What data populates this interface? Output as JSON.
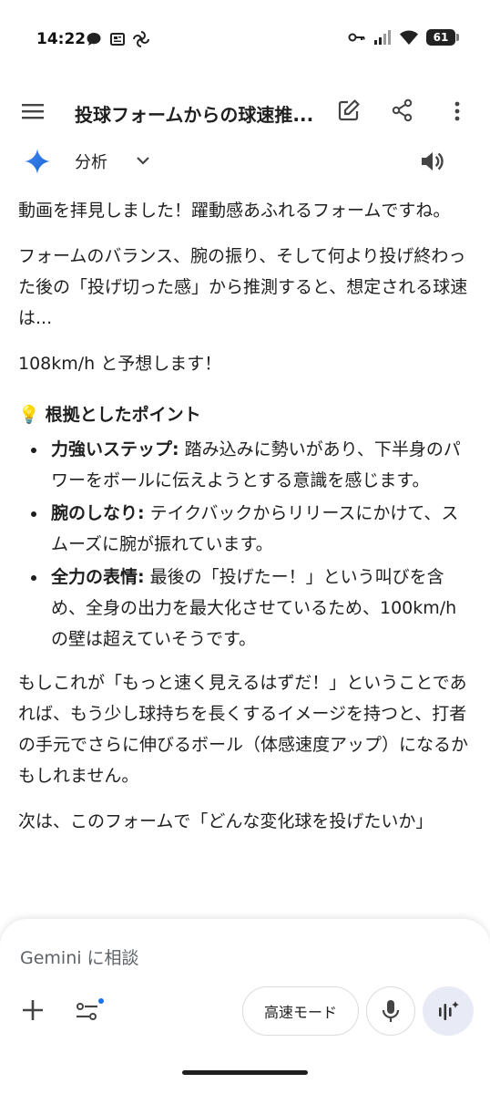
{
  "status_bar": {
    "time": "14:22",
    "battery": "61"
  },
  "app_bar": {
    "title": "投球フォームからの球速推..."
  },
  "model": {
    "label": "分析"
  },
  "message": {
    "p1": "動画を拝見しました！躍動感あふれるフォームですね。",
    "p2": "フォームのバランス、腕の振り、そして何より投げ終わった後の「投げ切った感」から推測すると、想定される球速は...",
    "p3": "108km/h と予想します！",
    "heading": "根拠としたポイント",
    "bullets": [
      {
        "title": "力強いステップ:",
        "text": " 踏み込みに勢いがあり、下半身のパワーをボールに伝えようとする意識を感じます。"
      },
      {
        "title": "腕のしなり:",
        "text": " テイクバックからリリースにかけて、スムーズに腕が振れています。"
      },
      {
        "title": "全力の表情:",
        "text": " 最後の「投げたー！」という叫びを含め、全身の出力を最大化させているため、100km/hの壁は超えていそうです。"
      }
    ],
    "p4": "もしこれが「もっと速く見えるはずだ！」ということであれば、もう少し球持ちを長くするイメージを持つと、打者の手元でさらに伸びるボール（体感速度アップ）になるかもしれません。",
    "p5": "次は、このフォームで「どんな変化球を投げたいか」"
  },
  "composer": {
    "placeholder": "Gemini に相談",
    "speed_mode": "高速モード"
  },
  "colors": {
    "accent": "#1a73e8",
    "gemini_gradient": [
      "#4285f4",
      "#1967d2"
    ]
  }
}
